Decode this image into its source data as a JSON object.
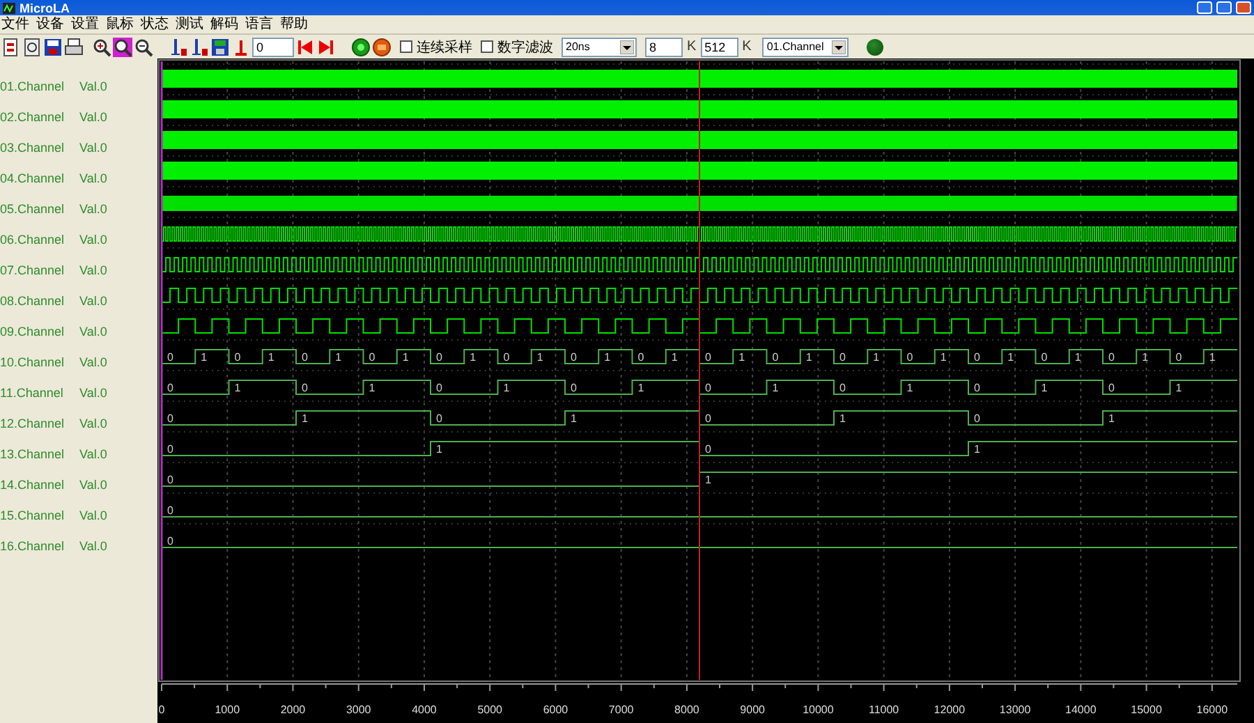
{
  "window": {
    "title": "MicroLA"
  },
  "menu": [
    "文件",
    "设备",
    "设置",
    "鼠标",
    "状态",
    "测试",
    "解码",
    "语言",
    "帮助"
  ],
  "toolbar": {
    "position_field": {
      "value": "0"
    },
    "checkboxes": [
      {
        "label": "连续采样",
        "checked": false
      },
      {
        "label": "数字滤波",
        "checked": false
      }
    ],
    "sample_rate": {
      "value": "20ns"
    },
    "depth_field": {
      "value": "8",
      "unit": "K"
    },
    "size_field": {
      "value": "512",
      "unit": "K"
    },
    "channel_select": {
      "value": "01.Channel"
    }
  },
  "channels": [
    {
      "name": "01.Channel",
      "value": "Val.0",
      "kind": "solid"
    },
    {
      "name": "02.Channel",
      "value": "Val.0",
      "kind": "solid"
    },
    {
      "name": "03.Channel",
      "value": "Val.0",
      "kind": "solid"
    },
    {
      "name": "04.Channel",
      "value": "Val.0",
      "kind": "solid"
    },
    {
      "name": "05.Channel",
      "value": "Val.0",
      "kind": "clock"
    },
    {
      "name": "06.Channel",
      "value": "Val.0",
      "kind": "clock"
    },
    {
      "name": "07.Channel",
      "value": "Val.0",
      "kind": "clock"
    },
    {
      "name": "08.Channel",
      "value": "Val.0",
      "kind": "clock"
    },
    {
      "name": "09.Channel",
      "value": "Val.0",
      "kind": "clock"
    },
    {
      "name": "10.Channel",
      "value": "Val.0",
      "kind": "bits",
      "bits": [
        "0",
        "1",
        "0",
        "1",
        "0",
        "1",
        "0",
        "1",
        "0",
        "1",
        "0",
        "1",
        "0",
        "1",
        "0",
        "1",
        "0",
        "1",
        "0",
        "1",
        "0",
        "1",
        "0",
        "1",
        "0",
        "1",
        "0",
        "1",
        "0",
        "1",
        "0",
        "1"
      ]
    },
    {
      "name": "11.Channel",
      "value": "Val.0",
      "kind": "bits",
      "bits": [
        "0",
        "1",
        "0",
        "1",
        "0",
        "1",
        "0",
        "1",
        "0",
        "1",
        "0",
        "1",
        "0",
        "1",
        "0",
        "1"
      ]
    },
    {
      "name": "12.Channel",
      "value": "Val.0",
      "kind": "bits",
      "bits": [
        "0",
        "1",
        "0",
        "1",
        "0",
        "1",
        "0",
        "1"
      ]
    },
    {
      "name": "13.Channel",
      "value": "Val.0",
      "kind": "bits",
      "bits": [
        "0",
        "1",
        "0",
        "1"
      ]
    },
    {
      "name": "14.Channel",
      "value": "Val.0",
      "kind": "bits",
      "bits": [
        "0",
        "1"
      ]
    },
    {
      "name": "15.Channel",
      "value": "Val.0",
      "kind": "bits",
      "bits": [
        "0"
      ]
    },
    {
      "name": "16.Channel",
      "value": "Val.0",
      "kind": "bits",
      "bits": [
        "0"
      ]
    }
  ],
  "axis": {
    "labels": [
      "0",
      "1000",
      "2000",
      "3000",
      "4000",
      "5000",
      "6000",
      "7000",
      "8000",
      "9000",
      "10000",
      "11000",
      "12000",
      "13000",
      "14000",
      "15000",
      "16000"
    ]
  }
}
